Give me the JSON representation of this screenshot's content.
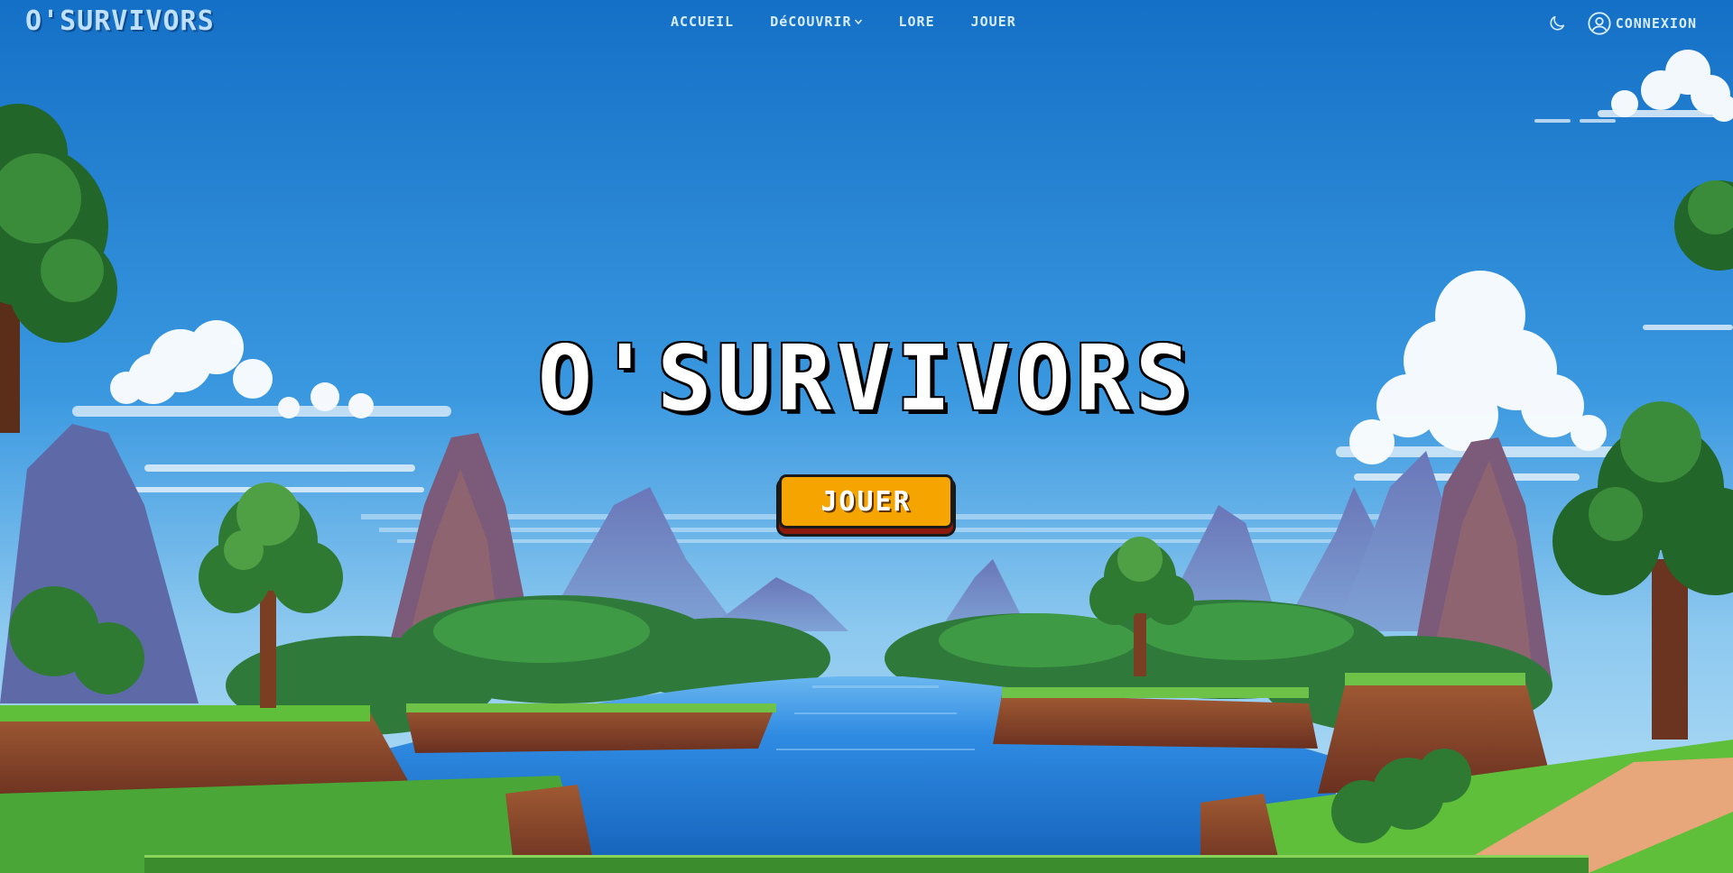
{
  "navbar": {
    "brand": "O'SURVIVORS",
    "links": [
      {
        "label": "ACCUEIL"
      },
      {
        "label": "DéCOUVRIR",
        "icon": "chevron-down-icon"
      },
      {
        "label": "LORE"
      },
      {
        "label": "JOUER"
      }
    ],
    "theme_toggle_icon": "moon-icon",
    "login": {
      "icon": "user-circle-icon",
      "label": "CONNEXION"
    }
  },
  "hero": {
    "title": "O'SURVIVORS",
    "play_label": "JOUER"
  },
  "colors": {
    "sky_top": "#1673c9",
    "sky_bottom": "#9fd4f3",
    "button": "#f6a400",
    "button_shadow": "#8b1a0d",
    "grass": "#5fbf3a",
    "cliff": "#8a4a2c",
    "water": "#2e8be0"
  }
}
